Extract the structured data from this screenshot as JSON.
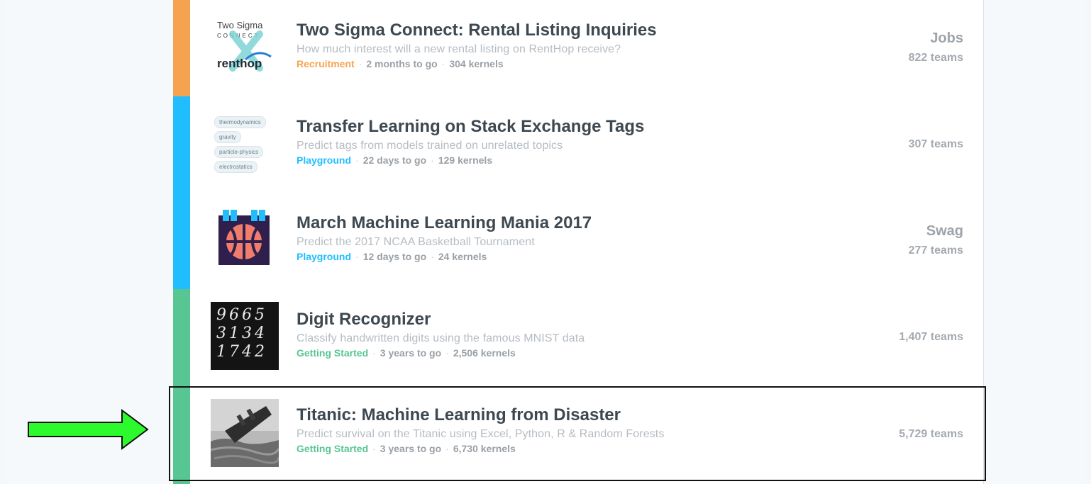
{
  "colors": {
    "recruitment": "#f6a34f",
    "playground": "#20beff",
    "getting_started": "#57c693",
    "arrow_fill": "#2dfa2d",
    "highlight_border": "#111111"
  },
  "competitions": [
    {
      "title": "Two Sigma Connect: Rental Listing Inquiries",
      "description": "How much interest will a new rental listing on RentHop receive?",
      "category": "Recruitment",
      "deadline": "2 months to go",
      "kernels": "304 kernels",
      "reward": "Jobs",
      "teams": "822 teams",
      "thumb": {
        "line1": "Two Sigma",
        "line2": "CONNECT",
        "line3": "renthop"
      }
    },
    {
      "title": "Transfer Learning on Stack Exchange Tags",
      "description": "Predict tags from models trained on unrelated topics",
      "category": "Playground",
      "deadline": "22 days to go",
      "kernels": "129 kernels",
      "reward": "",
      "teams": "307 teams",
      "thumb": {
        "tags": [
          "thermodynamics",
          "gravity",
          "particle-physics",
          "electrostatics"
        ]
      }
    },
    {
      "title": "March Machine Learning Mania 2017",
      "description": "Predict the 2017 NCAA Basketball Tournament",
      "category": "Playground",
      "deadline": "12 days to go",
      "kernels": "24 kernels",
      "reward": "Swag",
      "teams": "277 teams",
      "thumb": {
        "icon": "basketball-calendar-icon"
      }
    },
    {
      "title": "Digit Recognizer",
      "description": "Classify handwritten digits using the famous MNIST data",
      "category": "Getting Started",
      "deadline": "3 years to go",
      "kernels": "2,506 kernels",
      "reward": "",
      "teams": "1,407 teams",
      "thumb": {
        "digits": [
          "9665",
          "3134",
          "1742"
        ]
      }
    },
    {
      "title": "Titanic: Machine Learning from Disaster",
      "description": "Predict survival on the Titanic using Excel, Python, R & Random Forests",
      "category": "Getting Started",
      "deadline": "3 years to go",
      "kernels": "6,730 kernels",
      "reward": "",
      "teams": "5,729 teams",
      "thumb": {
        "icon": "titanic-sinking-image"
      }
    }
  ],
  "annotation": {
    "icon": "green-arrow-right-icon"
  }
}
